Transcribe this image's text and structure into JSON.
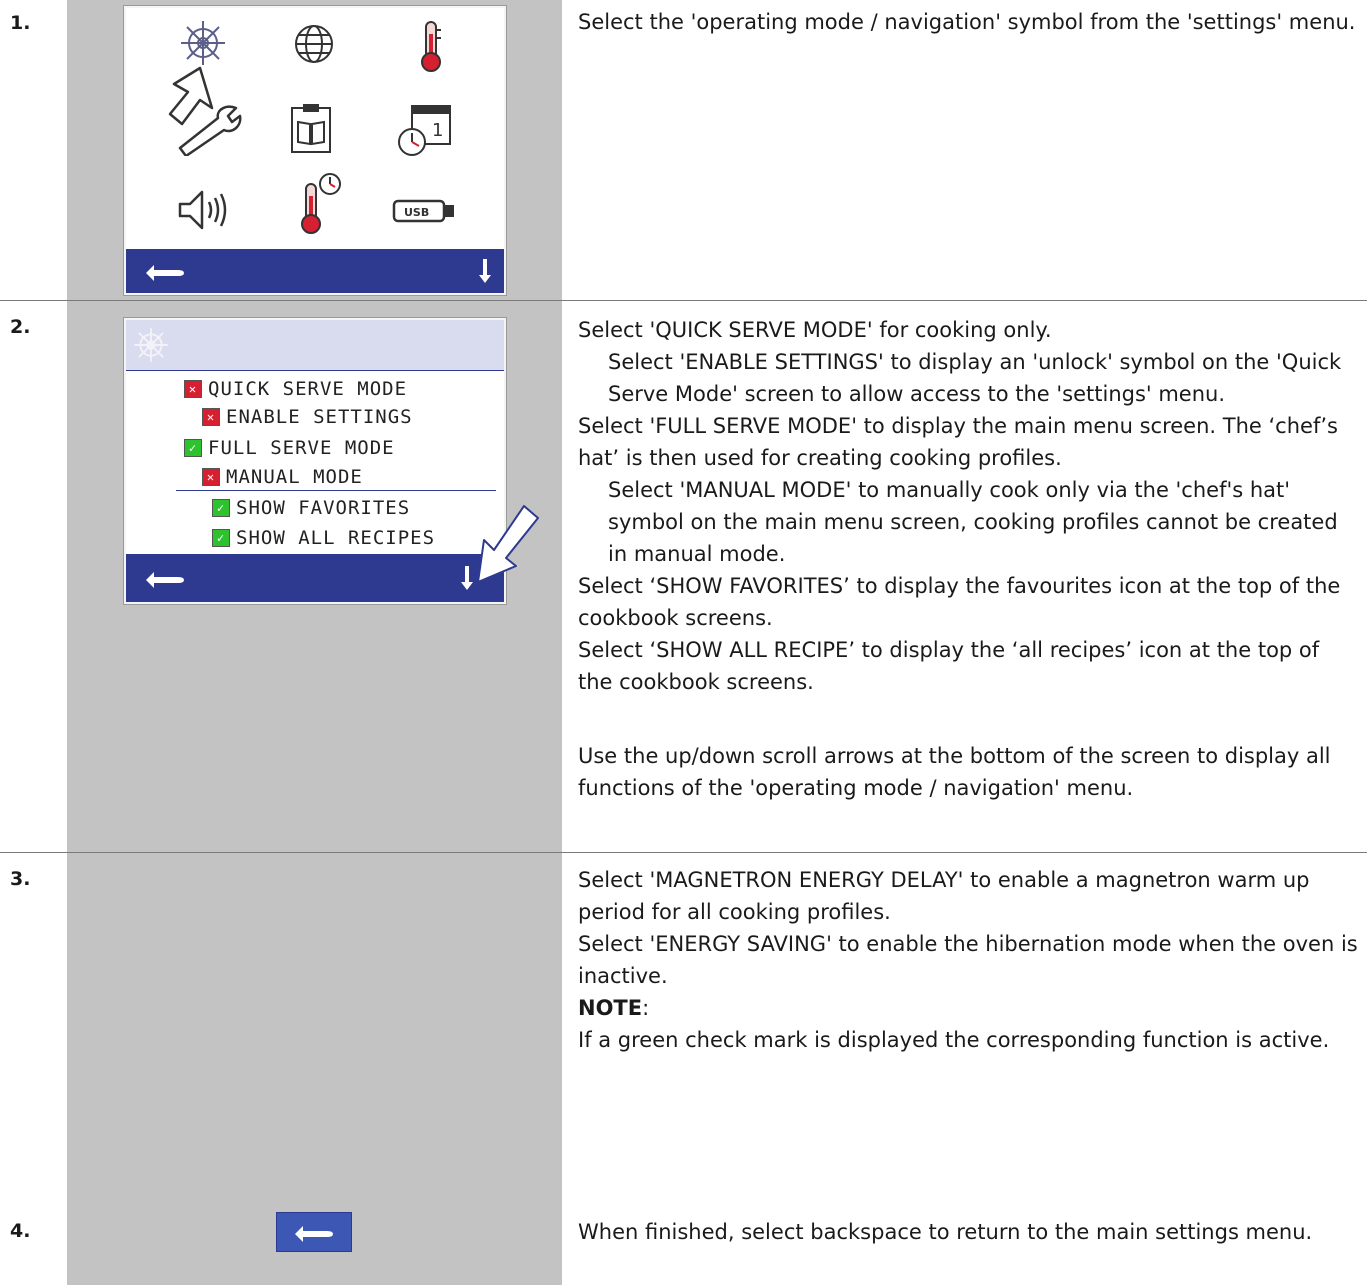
{
  "steps": [
    {
      "number": "1.",
      "paragraphs": [
        "Select the 'operating mode / navigation' symbol from the 'settings' menu."
      ]
    },
    {
      "number": "2.",
      "paragraphs": [
        "Select 'QUICK SERVE MODE' for cooking only.",
        "Select 'ENABLE SETTINGS' to display an 'unlock' symbol on the 'Quick Serve Mode' screen to allow access to the 'settings' menu.",
        "Select 'FULL SERVE MODE' to display the main menu screen. The ‘chef’s hat’ is then used for creating cooking profiles.",
        "Select 'MANUAL MODE' to manually cook only via the 'chef's hat' symbol on the main menu screen, cooking profiles cannot be created in manual mode.",
        "Select ‘SHOW FAVORITES’ to display the favourites icon at the top of the cookbook screens.",
        "Select ‘SHOW ALL RECIPE’ to display the ‘all recipes’ icon at the top of the cookbook screens.",
        "Use the up/down scroll arrows at the bottom of the screen to display all functions of the 'operating mode / navigation' menu."
      ]
    },
    {
      "number": "3.",
      "paragraphs": [
        "Select 'MAGNETRON ENERGY DELAY' to enable a magnetron warm up period for all cooking profiles.",
        "Select 'ENERGY SAVING' to enable the hibernation mode when the oven is inactive.",
        "NOTE",
        ":",
        "If a green check mark is displayed the corresponding function is active."
      ]
    },
    {
      "number": "4.",
      "paragraphs": [
        "When finished, select backspace to return to the main settings menu."
      ]
    }
  ],
  "menu_screen": {
    "items": [
      {
        "label": "QUICK SERVE MODE",
        "checked": false
      },
      {
        "label": "ENABLE SETTINGS",
        "checked": false
      },
      {
        "label": "FULL SERVE MODE",
        "checked": true
      },
      {
        "label": "MANUAL MODE",
        "checked": false
      },
      {
        "label": "SHOW FAVORITES",
        "checked": true
      },
      {
        "label": "SHOW ALL RECIPES",
        "checked": true
      }
    ],
    "checked_symbol": "✓",
    "unchecked_symbol": "✕"
  },
  "settings_icons": [
    "navigation-wheel-icon",
    "globe-icon",
    "thermometer-icon",
    "wrench-icon",
    "clipboard-book-icon",
    "calendar-clock-icon",
    "speaker-icon",
    "thermometer-clock-icon",
    "usb-icon"
  ],
  "usb_label": "USB",
  "calendar_day": "1",
  "colors": {
    "bar": "#2e3a8f",
    "column": "#c3c3c3",
    "checked": "#2fc22f",
    "unchecked": "#d42030"
  }
}
